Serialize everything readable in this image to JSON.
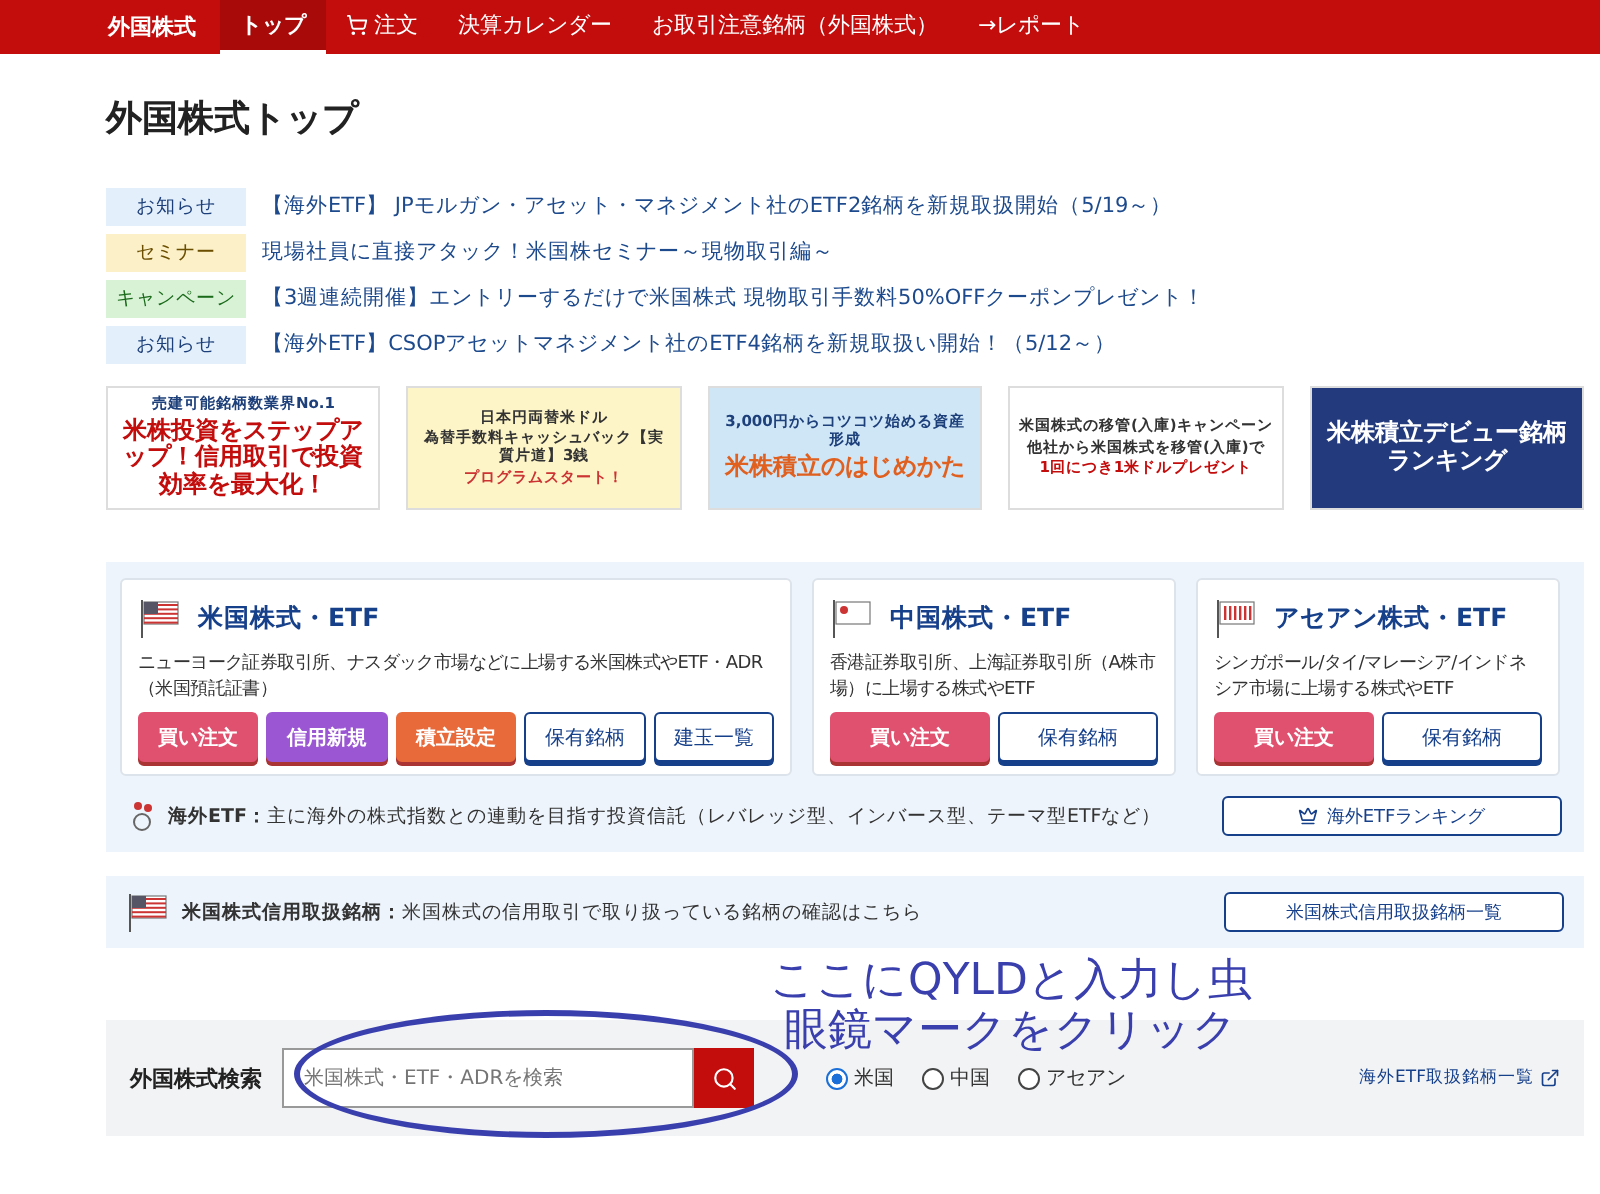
{
  "nav": {
    "brand": "外国株式",
    "items": [
      {
        "label": "トップ",
        "selected": true
      },
      {
        "label": "注文",
        "selected": false
      },
      {
        "label": "決算カレンダー",
        "selected": false
      },
      {
        "label": "お取引注意銘柄（外国株式）",
        "selected": false
      },
      {
        "label": "→レポート",
        "selected": false
      }
    ]
  },
  "title": "外国株式トップ",
  "news": [
    {
      "tag": "お知らせ",
      "kind": "info",
      "text": "【海外ETF】 JPモルガン・アセット・マネジメント社のETF2銘柄を新規取扱開始（5/19～）"
    },
    {
      "tag": "セミナー",
      "kind": "seminar",
      "text": "現場社員に直接アタック！米国株セミナー～現物取引編～"
    },
    {
      "tag": "キャンペーン",
      "kind": "campaign",
      "text": "【3週連続開催】エントリーするだけで米国株式 現物取引手数料50%OFFクーポンプレゼント！"
    },
    {
      "tag": "お知らせ",
      "kind": "info",
      "text": "【海外ETF】CSOPアセットマネジメント社のETF4銘柄を新規取扱い開始！（5/12～）"
    }
  ],
  "banners": [
    {
      "kind": "red",
      "lines": [
        "売建可能銘柄数業界No.1",
        "米株投資をステップアップ！信用取引で投資効率を最大化！"
      ]
    },
    {
      "kind": "yellow",
      "lines": [
        "日本円両替米ドル",
        "為替手数料キャッシュバック【実質片道】3銭",
        "プログラムスタート！"
      ]
    },
    {
      "kind": "sky",
      "lines": [
        "3,000円からコツコツ始める資産形成",
        "米株積立のはじめかた"
      ]
    },
    {
      "kind": "white",
      "lines": [
        "米国株式の移管(入庫)キャンペーン",
        "他社から米国株式を移管(入庫)で",
        "1回につき1米ドルプレゼント"
      ]
    },
    {
      "kind": "navy",
      "lines": [
        "米株積立デビュー銘柄ランキング"
      ]
    }
  ],
  "markets": [
    {
      "name": "米国株式・ETF",
      "desc": "ニューヨーク証券取引所、ナスダック市場などに上場する米国株式やETF・ADR（米国預託証書）",
      "buttons": [
        {
          "label": "買い注文",
          "kind": "buy"
        },
        {
          "label": "信用新規",
          "kind": "margin"
        },
        {
          "label": "積立設定",
          "kind": "saving"
        },
        {
          "label": "保有銘柄",
          "kind": "outline"
        },
        {
          "label": "建玉一覧",
          "kind": "outline"
        }
      ]
    },
    {
      "name": "中国株式・ETF",
      "desc": "香港証券取引所、上海証券取引所（A株市場）に上場する株式やETF",
      "buttons": [
        {
          "label": "買い注文",
          "kind": "buy"
        },
        {
          "label": "保有銘柄",
          "kind": "outline"
        }
      ]
    },
    {
      "name": "アセアン株式・ETF",
      "desc": "シンガポール/タイ/マレーシア/インドネシア市場に上場する株式やETF",
      "buttons": [
        {
          "label": "買い注文",
          "kind": "buy"
        },
        {
          "label": "保有銘柄",
          "kind": "outline"
        }
      ]
    }
  ],
  "etf_row": {
    "label": "海外ETF：",
    "text": "主に海外の株式指数との連動を目指す投資信託（レバレッジ型、インバース型、テーマ型ETFなど）",
    "button": "海外ETFランキング"
  },
  "margin_row": {
    "label": "米国株式信用取扱銘柄：",
    "text": "米国株式の信用取引で取り扱っている銘柄の確認はこちら",
    "button": "米国株式信用取扱銘柄一覧"
  },
  "search": {
    "label": "外国株式検索",
    "placeholder": "米国株式・ETF・ADRを検索",
    "markets": [
      {
        "label": "米国",
        "selected": true
      },
      {
        "label": "中国",
        "selected": false
      },
      {
        "label": "アセアン",
        "selected": false
      }
    ],
    "link": "海外ETF取扱銘柄一覧"
  },
  "annotation": {
    "lines": [
      "ここにQYLDと入力し虫",
      "眼鏡マークをクリック"
    ]
  }
}
